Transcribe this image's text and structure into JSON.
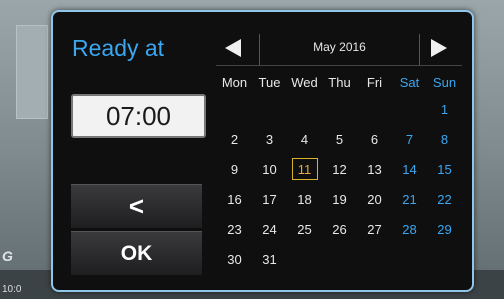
{
  "background": {
    "clock": "10:0",
    "logo": "G"
  },
  "dialog": {
    "title": "Ready at",
    "time_value": "07:00",
    "back_label": "<",
    "ok_label": "OK",
    "month_label": "May 2016",
    "selected_day": "11",
    "weekday_headers": [
      "Mon",
      "Tue",
      "Wed",
      "Thu",
      "Fri",
      "Sat",
      "Sun"
    ],
    "weeks": [
      [
        "",
        "",
        "",
        "",
        "",
        "",
        "1"
      ],
      [
        "2",
        "3",
        "4",
        "5",
        "6",
        "7",
        "8"
      ],
      [
        "9",
        "10",
        "11",
        "12",
        "13",
        "14",
        "15"
      ],
      [
        "16",
        "17",
        "18",
        "19",
        "20",
        "21",
        "22"
      ],
      [
        "23",
        "24",
        "25",
        "26",
        "27",
        "28",
        "29"
      ],
      [
        "30",
        "31",
        "",
        "",
        "",
        "",
        ""
      ]
    ]
  },
  "colors": {
    "accent": "#3aa7f0",
    "selected_border": "#d7b22b",
    "dialog_border": "#8fc6e8"
  }
}
